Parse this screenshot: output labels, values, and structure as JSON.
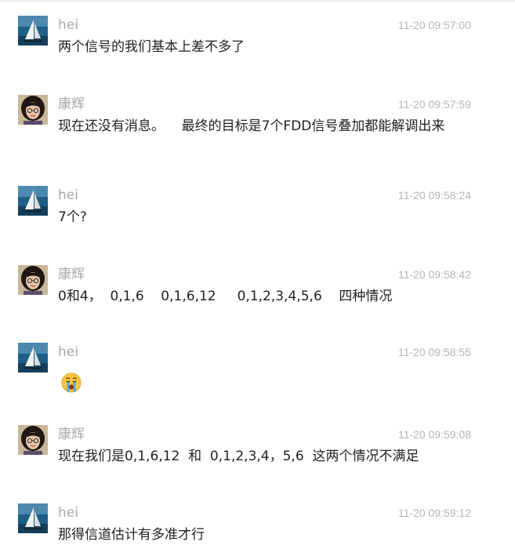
{
  "messages": [
    {
      "sender": "hei",
      "time": "11-20 09:57:00",
      "text": "两个信号的我们基本上差不多了",
      "avatar": "sailboat-avatar-icon"
    },
    {
      "sender": "康辉",
      "time": "11-20 09:57:59",
      "text": "现在还没有消息。    最终的目标是7个FDD信号叠加都能解调出来",
      "avatar": "user-photo-avatar-icon"
    },
    {
      "sender": "hei",
      "time": "11-20 09:58:24",
      "text": "7个?",
      "avatar": "sailboat-avatar-icon"
    },
    {
      "sender": "康辉",
      "time": "11-20 09:58:42",
      "text": "0和4，  0,1,6    0,1,6,12     0,1,2,3,4,5,6    四种情况",
      "avatar": "user-photo-avatar-icon"
    },
    {
      "sender": "hei",
      "time": "11-20 09:58:55",
      "text": "",
      "emoji": "crying-face-emoji-icon",
      "avatar": "sailboat-avatar-icon"
    },
    {
      "sender": "康辉",
      "time": "11-20 09:59:08",
      "text": "现在我们是0,1,6,12  和  0,1,2,3,4，5,6  这两个情况不满足",
      "avatar": "user-photo-avatar-icon"
    },
    {
      "sender": "hei",
      "time": "11-20 09:59:12",
      "text": "那得信道估计有多准才行",
      "avatar": "sailboat-avatar-icon"
    }
  ]
}
